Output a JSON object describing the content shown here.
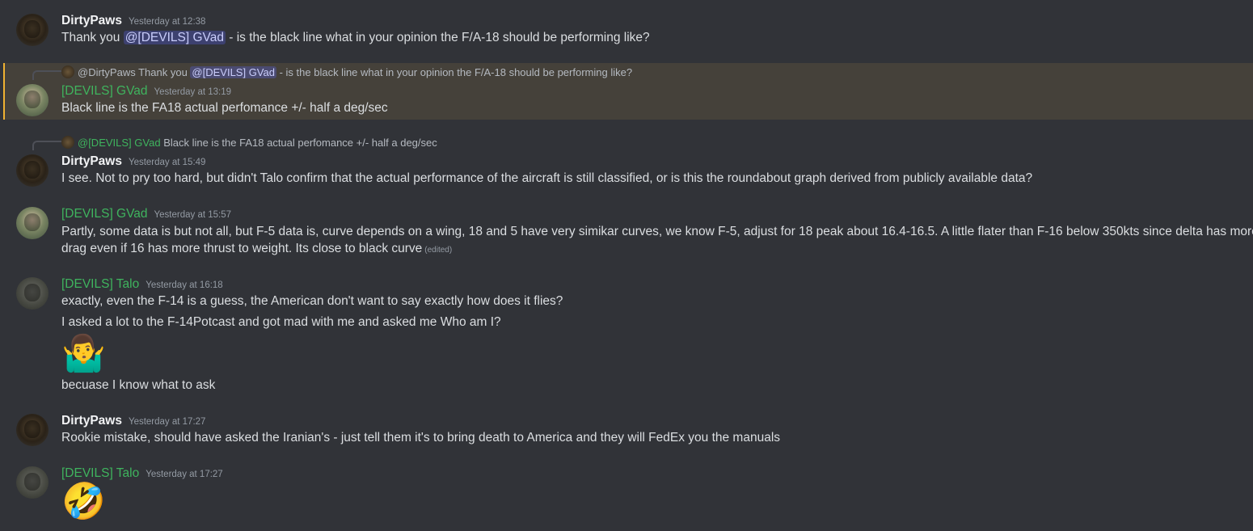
{
  "messages": [
    {
      "author": "DirtyPaws",
      "timestamp": "Yesterday at 12:38",
      "text_before": "Thank you ",
      "mention": "@[DEVILS] GVad",
      "text_after": " - is the black line what in your opinion the F/A-18 should be performing like?"
    },
    {
      "reply_to": {
        "author": "@DirtyPaws",
        "text_before": "Thank you ",
        "mention": "@[DEVILS] GVad",
        "text_after": " - is the black line what in your opinion the F/A-18 should be performing like?"
      },
      "author": "[DEVILS] GVad",
      "timestamp": "Yesterday at 13:19",
      "text": "Black line is the FA18 actual perfomance +/- half a deg/sec"
    },
    {
      "reply_to": {
        "author": "@[DEVILS] GVad",
        "text": "Black line is the FA18 actual perfomance +/- half a deg/sec"
      },
      "author": "DirtyPaws",
      "timestamp": "Yesterday at 15:49",
      "text": "I see. Not to pry too hard, but didn't Talo confirm that the actual performance of the aircraft is still classified, or is this the roundabout graph derived from publicly available data?"
    },
    {
      "author": "[DEVILS] GVad",
      "timestamp": "Yesterday at 15:57",
      "line1": "Partly, some data is but not all, but F-5 data is, curve depends on a wing, 18 and 5 have very simikar curves, we know F-5, adjust for 18 peak about 16.4-16.5. A little flater than F-16 below 350kts since delta has more",
      "line2": "drag even if 16 has more thrust to weight. Its close to black curve",
      "edited": "(edited)"
    },
    {
      "author": "[DEVILS] Talo",
      "timestamp": "Yesterday at 16:18",
      "line1": "exactly, even the F-14 is a guess, the American don't want to say exactly how does it flies?",
      "line2": "I asked a lot to the F-14Potcast and got mad with me and asked me Who am I?",
      "emoji": "🤷‍♂️",
      "line3": "becuase I know what to ask"
    },
    {
      "author": "DirtyPaws",
      "timestamp": "Yesterday at 17:27",
      "text": "Rookie mistake, should have asked the Iranian's - just tell them it's to bring death to America and they will FedEx you the manuals"
    },
    {
      "author": "[DEVILS] Talo",
      "timestamp": "Yesterday at 17:27",
      "emoji": "🤣"
    }
  ]
}
